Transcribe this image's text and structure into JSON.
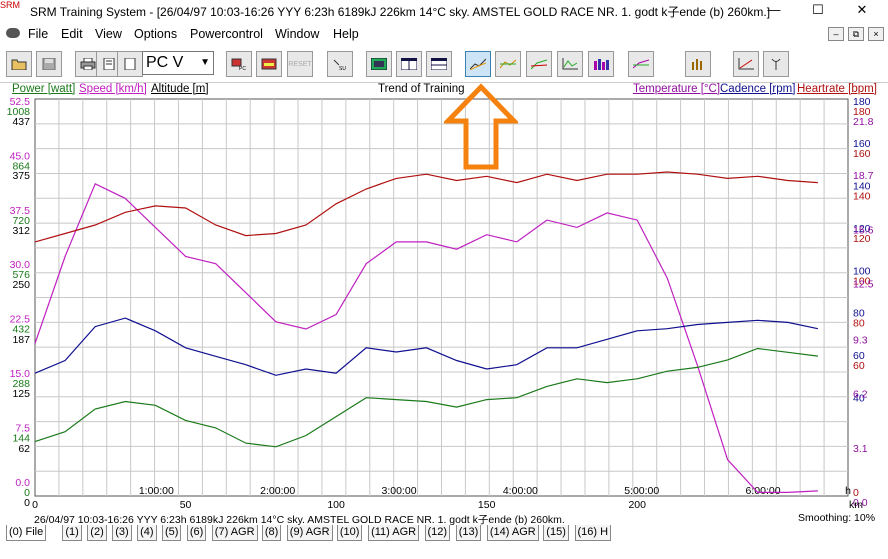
{
  "window": {
    "title": "SRM Training System - [26/04/97 10:03-16:26 YYY 6:23h 6189kJ 226km 14°C sky. AMSTEL GOLD RACE NR. 1. godt k子ende (b) 260km.]",
    "app_icon_text": "SRM"
  },
  "menu": [
    "File",
    "Edit",
    "View",
    "Options",
    "Powercontrol",
    "Window",
    "Help"
  ],
  "toolbar": {
    "mode_select": "PC V",
    "reset_label": "RESET"
  },
  "legend": {
    "left": [
      "Power [watt]",
      "Speed [km/h]",
      "Altitude [m]"
    ],
    "center": "Trend of Training",
    "right": [
      "Temperature [°C]",
      "Cadence [rpm]",
      "Heartrate [bpm]"
    ]
  },
  "colors": {
    "power": "#1a7a1a",
    "speed": "#c020c0",
    "altitude": "#000000",
    "temperature": "#9010a0",
    "cadence": "#101090",
    "heartrate": "#b01010",
    "arrow": "#f5820f"
  },
  "chart_data": {
    "type": "line",
    "title": "Trend of Training",
    "x_time_ticks": [
      "1:00:00",
      "2:00:00",
      "3:00:00",
      "4:00:00",
      "5:00:00",
      "6:00:00",
      "h"
    ],
    "x_km_ticks": [
      "0",
      "50",
      "100",
      "150",
      "200",
      "km"
    ],
    "y_axes": {
      "speed": [
        "0.0",
        "7.5",
        "15.0",
        "22.5",
        "30.0",
        "37.5",
        "45.0",
        "52.5"
      ],
      "power": [
        "0",
        "144",
        "288",
        "432",
        "576",
        "720",
        "864",
        "1008"
      ],
      "altitude": [
        "0",
        "62",
        "125",
        "187",
        "250",
        "312",
        "375",
        "437"
      ],
      "heartrate": [
        "0",
        "60",
        "80",
        "100",
        "120",
        "140",
        "160",
        "180"
      ],
      "cadence": [
        "20",
        "40",
        "60",
        "80",
        "100",
        "120",
        "140",
        "160",
        "180"
      ],
      "temperature": [
        "0.0",
        "3.1",
        "6.2",
        "9.3",
        "12.5",
        "15.6",
        "18.7",
        "21.8"
      ]
    },
    "series": [
      {
        "name": "Speed [km/h]",
        "x_km": [
          0,
          10,
          20,
          30,
          40,
          50,
          60,
          70,
          80,
          90,
          100,
          110,
          120,
          130,
          140,
          150,
          160,
          170,
          180,
          190,
          200,
          210,
          220,
          230,
          240,
          250,
          260
        ],
        "values": [
          21,
          33,
          43,
          41,
          37,
          33,
          32,
          28,
          24,
          23,
          25,
          32,
          35,
          35,
          34,
          36,
          35,
          38,
          37,
          39,
          38,
          30,
          18,
          5,
          0.5,
          0.5,
          0.7
        ]
      },
      {
        "name": "Power [watt]",
        "x_km": [
          0,
          10,
          20,
          30,
          40,
          50,
          60,
          70,
          80,
          90,
          100,
          110,
          120,
          130,
          140,
          150,
          160,
          170,
          180,
          190,
          200,
          210,
          220,
          230,
          240,
          250,
          260
        ],
        "values": [
          144,
          170,
          230,
          250,
          240,
          200,
          180,
          140,
          130,
          160,
          210,
          260,
          255,
          250,
          235,
          255,
          260,
          290,
          310,
          300,
          310,
          330,
          340,
          360,
          390,
          380,
          370
        ]
      },
      {
        "name": "Heartrate [bpm]",
        "x_km": [
          0,
          10,
          20,
          30,
          40,
          50,
          60,
          70,
          80,
          90,
          100,
          110,
          120,
          130,
          140,
          150,
          160,
          170,
          180,
          190,
          200,
          210,
          220,
          230,
          240,
          250,
          260
        ],
        "values": [
          120,
          124,
          128,
          134,
          137,
          136,
          128,
          123,
          124,
          128,
          138,
          145,
          150,
          152,
          149,
          151,
          148,
          152,
          149,
          152,
          152,
          153,
          152,
          150,
          151,
          149,
          148
        ]
      },
      {
        "name": "Cadence [rpm]",
        "x_km": [
          0,
          10,
          20,
          30,
          40,
          50,
          60,
          70,
          80,
          90,
          100,
          110,
          120,
          130,
          140,
          150,
          160,
          170,
          180,
          190,
          200,
          210,
          220,
          230,
          240,
          250,
          260
        ],
        "values": [
          58,
          64,
          80,
          84,
          78,
          70,
          66,
          62,
          57,
          60,
          58,
          70,
          68,
          70,
          64,
          60,
          62,
          70,
          70,
          74,
          78,
          79,
          81,
          82,
          83,
          82,
          79
        ]
      }
    ]
  },
  "status": {
    "info": "26/04/97 10:03-16:26 YYY 6:23h 6189kJ 226km 14°C sky. AMSTEL GOLD RACE NR. 1. godt k子ende (b) 260km.",
    "smoothing": "Smoothing: 10%"
  },
  "tabs": [
    "(0) File",
    "(1)",
    "(2)",
    "(3)",
    "(4)",
    "(5)",
    "(6)",
    "(7) AGR",
    "(8)",
    "(9) AGR",
    "(10)",
    "(11) AGR",
    "(12)",
    "(13)",
    "(14) AGR",
    "(15)",
    "(16) H"
  ]
}
